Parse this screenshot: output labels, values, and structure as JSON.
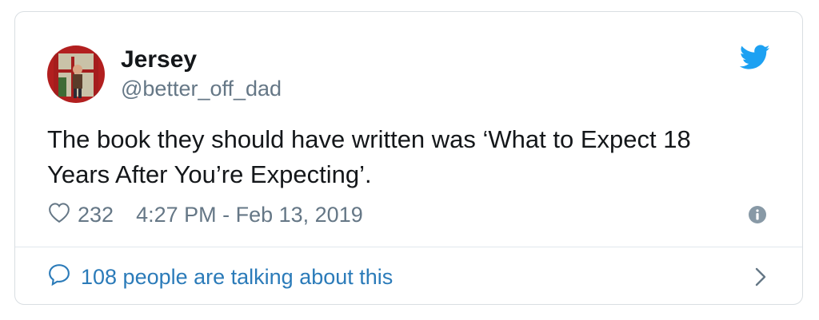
{
  "tweet": {
    "author": {
      "display_name": "Jersey",
      "handle": "@better_off_dad"
    },
    "text": "The book they should have written was ‘What to Expect 18 Years After You’re Expecting’.",
    "likes": "232",
    "timestamp": "4:27 PM - Feb 13, 2019",
    "conversation": "108 people are talking about this"
  },
  "icons": {
    "brand": "twitter-bird-icon",
    "like": "heart-icon",
    "info": "info-icon",
    "conversation": "speech-bubble-icon",
    "chevron": "chevron-right-icon"
  },
  "colors": {
    "brand_blue": "#1da1f2",
    "link_blue": "#2b7bb9",
    "muted_gray": "#657786",
    "text_dark": "#14171a"
  }
}
